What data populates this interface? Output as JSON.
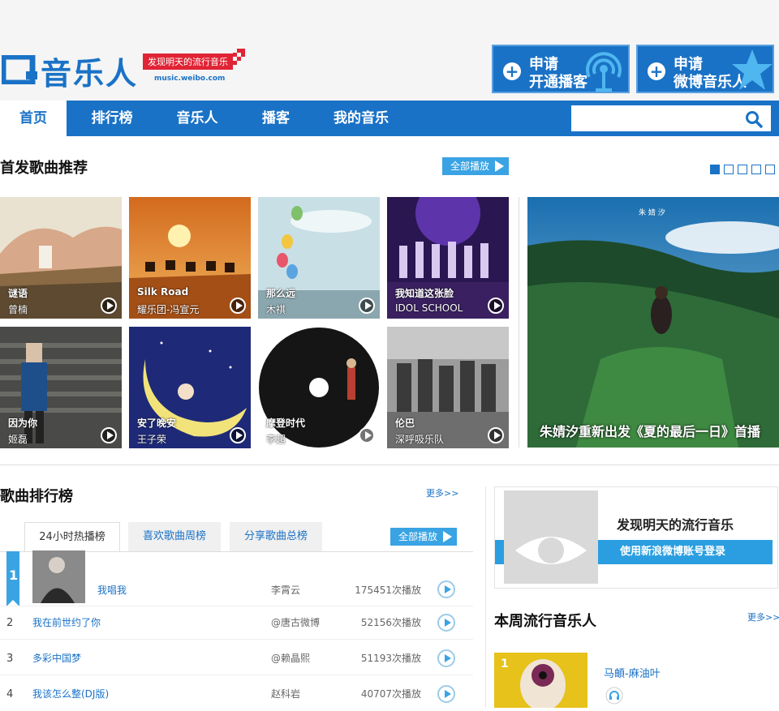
{
  "brand": {
    "logo_text": "音乐人",
    "slogan": "发现明天的流行音乐",
    "url": "music.weibo.com",
    "primary_color": "#1a72c6",
    "accent_color": "#e02435"
  },
  "header_buttons": [
    {
      "line1": "申请",
      "line2": "开通播客",
      "icon": "broadcast-icon"
    },
    {
      "line1": "申请",
      "line2": "微博音乐人",
      "icon": "star-icon"
    }
  ],
  "nav": {
    "items": [
      "首页",
      "排行榜",
      "音乐人",
      "播客",
      "我的音乐"
    ],
    "active_index": 0,
    "search_placeholder": ""
  },
  "recommend": {
    "title": "首发歌曲推荐",
    "play_all": "全部播放",
    "pages": 5,
    "active_page": 1,
    "tiles": [
      {
        "name": "谜语",
        "artist": "曾楠"
      },
      {
        "name": "Silk Road",
        "artist": "耀乐团-冯宣元"
      },
      {
        "name": "那么远",
        "artist": "木祺"
      },
      {
        "name": "我知道这张脸",
        "artist": "IDOL SCHOOL"
      },
      {
        "name": "因为你",
        "artist": "姬磊"
      },
      {
        "name": "安了晚安",
        "artist": "王子荣"
      },
      {
        "name": "摩登时代",
        "artist": "李超"
      },
      {
        "name": "伦巴",
        "artist": "深呼吸乐队"
      }
    ],
    "feature": {
      "caption": "朱婧汐重新出发《夏的最后一日》首播",
      "small_text": "朱 婧 汐"
    }
  },
  "chart": {
    "title": "歌曲排行榜",
    "more": "更多>>",
    "tabs": [
      "24小时热播榜",
      "喜欢歌曲周榜",
      "分享歌曲总榜"
    ],
    "active_tab": 0,
    "play_all": "全部播放",
    "rows": [
      {
        "rank": "1",
        "title": "我唱我",
        "singer": "李霄云",
        "plays": "175451次播放"
      },
      {
        "rank": "2",
        "title": "我在前世约了你",
        "singer": "@唐古微博",
        "plays": "52156次播放"
      },
      {
        "rank": "3",
        "title": "多彩中国梦",
        "singer": "@赖晶熙",
        "plays": "51193次播放"
      },
      {
        "rank": "4",
        "title": "我该怎么整(DJ版)",
        "singer": "赵科岩",
        "plays": "40707次播放"
      }
    ]
  },
  "sidebar": {
    "login_title": "发现明天的流行音乐",
    "login_button": "使用新浪微博账号登录",
    "weekly_title": "本周流行音乐人",
    "more": "更多>>",
    "top_artist": {
      "rank": "1",
      "name": "马頔-麻油叶"
    }
  }
}
